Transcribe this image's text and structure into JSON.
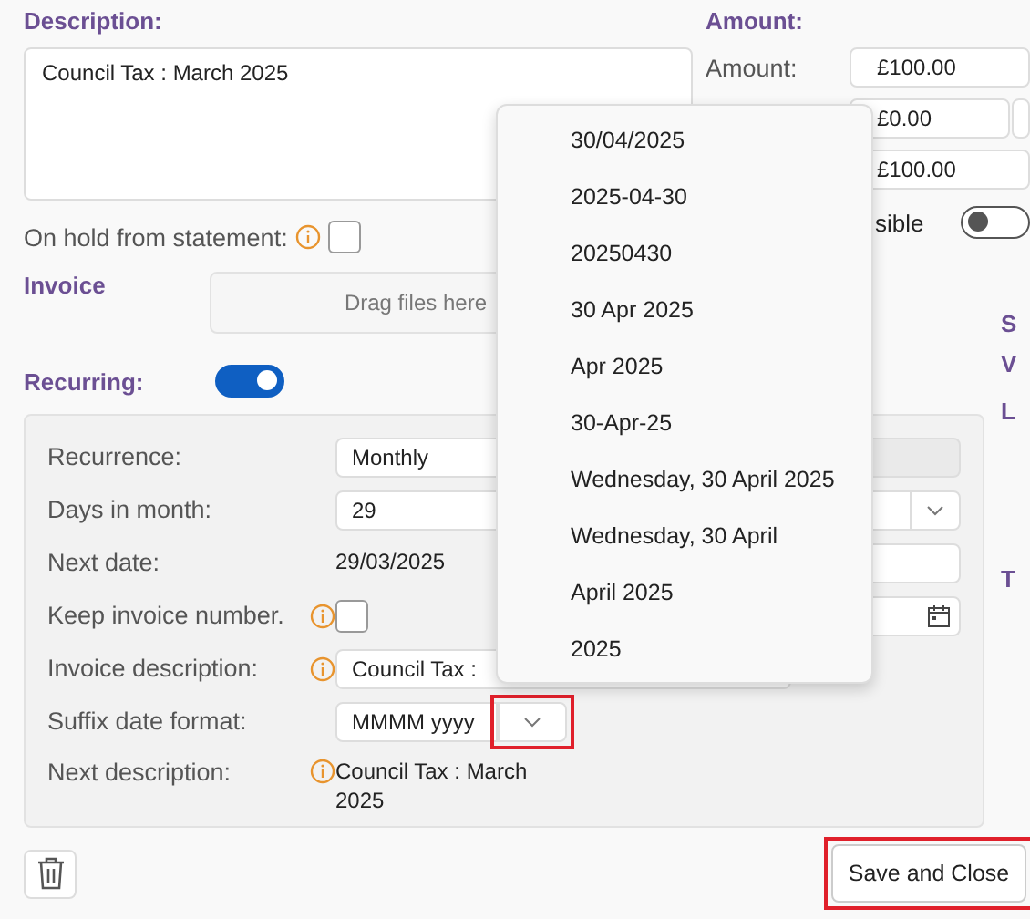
{
  "description": {
    "heading": "Description:",
    "value": "Council Tax : March 2025"
  },
  "on_hold": {
    "label": "On hold from statement:",
    "checked": false
  },
  "invoice": {
    "label": "Invoice",
    "dropzone": "Drag files here"
  },
  "amount": {
    "heading": "Amount:",
    "label": "Amount:",
    "fields": [
      "£100.00",
      "£0.00",
      "£100.00"
    ]
  },
  "visible": {
    "label": "sible",
    "on": false
  },
  "side_labels": [
    "S",
    "V",
    "L",
    "T"
  ],
  "recurring": {
    "label": "Recurring:",
    "on": true,
    "rows": [
      {
        "kind": "select",
        "label": "Recurrence:",
        "value": "Monthly",
        "aside": {
          "kind": "field"
        }
      },
      {
        "kind": "input",
        "label": "Days in month:",
        "value": "29",
        "aside": {
          "kind": "select"
        }
      },
      {
        "kind": "text",
        "label": "Next date:",
        "value": "29/03/2025",
        "aside": {
          "kind": "field"
        }
      },
      {
        "kind": "checkbox",
        "label": "Keep invoice number.",
        "info": true,
        "checked": false,
        "aside": {
          "kind": "date"
        }
      },
      {
        "kind": "input",
        "label": "Invoice description:",
        "info": true,
        "value": "Council Tax :"
      },
      {
        "kind": "combo",
        "label": "Suffix date format:",
        "value": "MMMM yyyy",
        "highlighted": true
      },
      {
        "kind": "text",
        "label": "Next description:",
        "info": true,
        "value": "Council Tax : March 2025"
      }
    ]
  },
  "date_format_menu": [
    "30/04/2025",
    "2025-04-30",
    "20250430",
    "30 Apr 2025",
    "Apr 2025",
    "30-Apr-25",
    "Wednesday, 30 April 2025",
    "Wednesday, 30 April",
    "April 2025",
    "2025"
  ],
  "save_button": {
    "label": "Save and Close",
    "highlighted": true
  }
}
